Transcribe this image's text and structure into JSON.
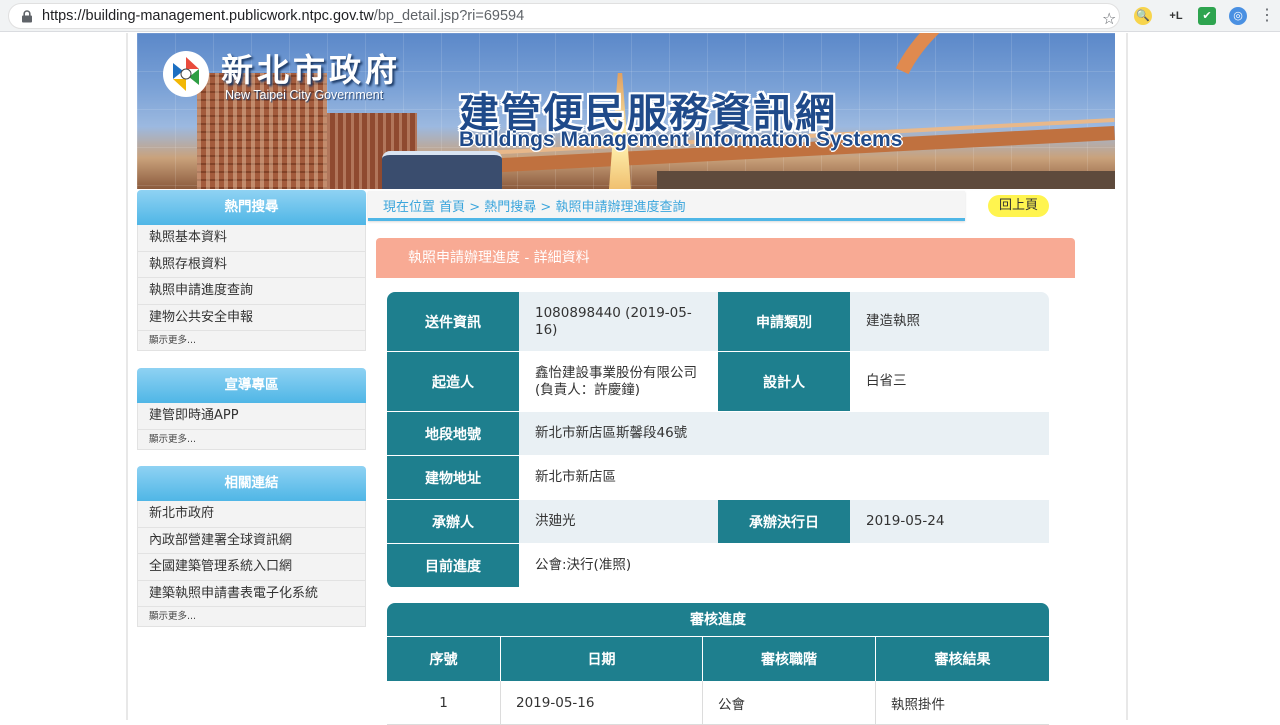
{
  "browser": {
    "url_main": "https://building-management.publicwork.ntpc.gov.tw",
    "url_rest": "/bp_detail.jsp?ri=69594",
    "ext_lplus": "+L"
  },
  "banner": {
    "gov_cn": "新北市政府",
    "gov_en": "New Taipei City Government",
    "title": "建管便民服務資訊網",
    "subtitle": "Buildings Management Information Systems"
  },
  "sidebar": {
    "popular": {
      "header": "熱門搜尋",
      "items": [
        "執照基本資料",
        "執照存根資料",
        "執照申請進度查詢",
        "建物公共安全申報"
      ],
      "more": "顯示更多..."
    },
    "promo": {
      "header": "宣導專區",
      "items": [
        "建管即時通APP"
      ],
      "more": "顯示更多..."
    },
    "links": {
      "header": "相關連結",
      "items": [
        "新北市政府",
        "內政部營建署全球資訊網",
        "全國建築管理系統入口網",
        "建築執照申請書表電子化系統"
      ],
      "more": "顯示更多..."
    }
  },
  "breadcrumb": "現在位置 首頁 > 熱門搜尋 > 執照申請辦理進度查詢",
  "back_button": "回上頁",
  "section_title": "執照申請辦理進度 - 詳細資料",
  "detail": {
    "submit_label": "送件資訊",
    "submit_value": "1080898440 (2019-05-16)",
    "type_label": "申請類別",
    "type_value": "建造執照",
    "applicant_label": "起造人",
    "applicant_value": "鑫怡建設事業股份有限公司(負責人：許慶鐘)",
    "designer_label": "設計人",
    "designer_value": "白省三",
    "lot_label": "地段地號",
    "lot_value": "新北市新店區斯馨段46號",
    "address_label": "建物地址",
    "address_value": "新北市新店區",
    "handler_label": "承辦人",
    "handler_value": "洪廸光",
    "decision_label": "承辦決行日",
    "decision_value": "2019-05-24",
    "progress_label": "目前進度",
    "progress_value": "公會:決行(准照)"
  },
  "review": {
    "title": "審核進度",
    "headers": [
      "序號",
      "日期",
      "審核職階",
      "審核結果"
    ],
    "rows": [
      {
        "no": "1",
        "date": "2019-05-16",
        "level": "公會",
        "result": "執照掛件"
      }
    ]
  }
}
